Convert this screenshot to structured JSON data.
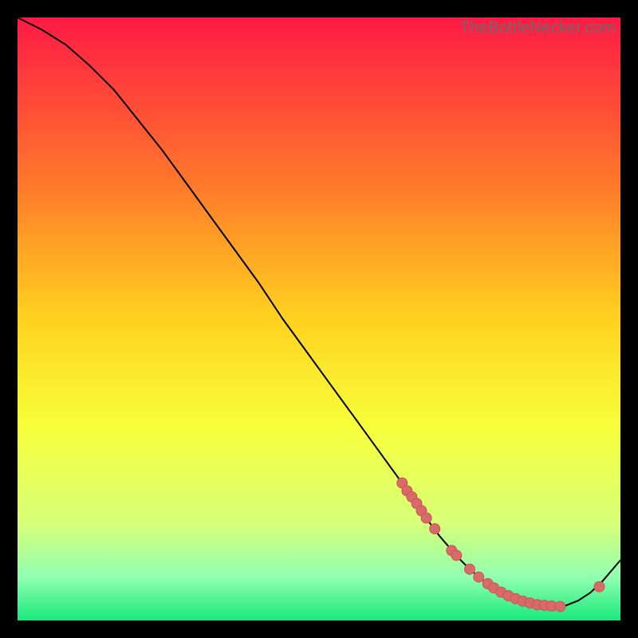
{
  "watermark": "TheBottleNecker.com",
  "colors": {
    "bg_black": "#000000",
    "gradient_top": "#ff1a45",
    "gradient_mid1": "#ff7a2a",
    "gradient_mid2": "#ffd21f",
    "gradient_mid3": "#f7ff3a",
    "gradient_low1": "#d6ff7a",
    "gradient_low2": "#8fffb0",
    "gradient_bottom": "#17e87a",
    "curve": "#000000",
    "marker_fill": "#d86a6a",
    "marker_stroke": "#c95555"
  },
  "chart_data": {
    "type": "line",
    "title": "",
    "xlabel": "",
    "ylabel": "",
    "xlim": [
      0,
      100
    ],
    "ylim": [
      0,
      100
    ],
    "series": [
      {
        "name": "bottleneck-curve",
        "x": [
          0,
          4,
          8,
          12,
          16,
          20,
          24,
          28,
          32,
          36,
          40,
          44,
          48,
          52,
          56,
          60,
          64,
          67,
          70,
          73,
          75,
          77,
          79,
          81,
          83,
          85,
          87,
          89,
          91,
          93,
          95,
          97,
          100
        ],
        "y": [
          100,
          98,
          95.5,
          92,
          88,
          83,
          78,
          72.5,
          67,
          61.5,
          56,
          50,
          44.5,
          39,
          33.5,
          28,
          22.5,
          18,
          14,
          10.5,
          8.5,
          6.8,
          5.4,
          4.2,
          3.3,
          2.7,
          2.4,
          2.3,
          2.5,
          3.3,
          4.6,
          6.5,
          10
        ]
      }
    ],
    "markers": {
      "name": "highlighted-points",
      "x": [
        63.8,
        64.6,
        65.4,
        66.2,
        67.0,
        67.8,
        69.2,
        72.0,
        72.8,
        75.0,
        76.5,
        78.0,
        79.0,
        80.2,
        81.4,
        82.6,
        83.8,
        85.0,
        86.2,
        87.4,
        88.6,
        90.0,
        96.5
      ],
      "y": [
        22.8,
        21.5,
        20.5,
        19.4,
        18.2,
        17.0,
        15.2,
        11.6,
        10.8,
        8.5,
        7.2,
        6.1,
        5.4,
        4.7,
        4.1,
        3.6,
        3.2,
        2.9,
        2.6,
        2.5,
        2.4,
        2.3,
        5.6
      ]
    }
  }
}
